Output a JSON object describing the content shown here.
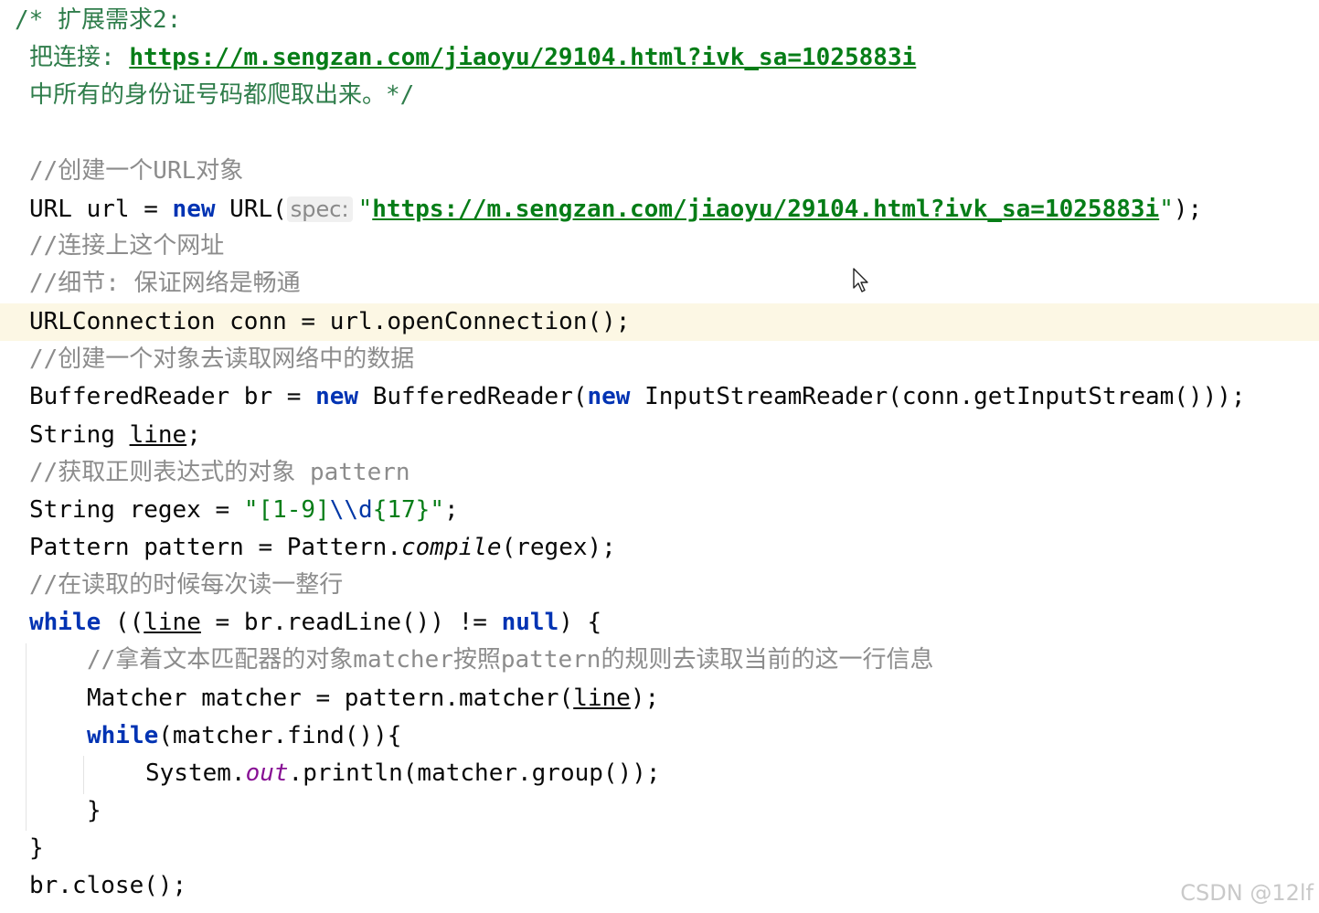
{
  "editor": {
    "lines": [
      {
        "id": "l1",
        "parts": [
          {
            "t": "/* 扩展需求2:",
            "c": "cmt-green"
          }
        ]
      },
      {
        "id": "l2",
        "parts": [
          {
            "t": "把连接: ",
            "c": "cmt-green"
          },
          {
            "t": "https://m.sengzan.com/jiaoyu/29104.html?ivk_sa=1025883i",
            "c": "url"
          }
        ]
      },
      {
        "id": "l3",
        "parts": [
          {
            "t": "中所有的身份证号码都爬取出来。*/",
            "c": "cmt-green"
          }
        ]
      },
      {
        "id": "l4",
        "parts": []
      },
      {
        "id": "l5",
        "parts": [
          {
            "t": "//创建一个URL对象",
            "c": "cmt"
          }
        ]
      },
      {
        "id": "l6",
        "parts": [
          {
            "t": "URL url = ",
            "c": ""
          },
          {
            "t": "new",
            "c": "kw"
          },
          {
            "t": " URL(",
            "c": ""
          },
          {
            "t": "spec:",
            "c": "hint"
          },
          {
            "t": "\"",
            "c": "str"
          },
          {
            "t": "https://m.sengzan.com/jiaoyu/29104.html?ivk_sa=1025883i",
            "c": "url"
          },
          {
            "t": "\"",
            "c": "str"
          },
          {
            "t": ");",
            "c": ""
          }
        ]
      },
      {
        "id": "l7",
        "parts": [
          {
            "t": "//连接上这个网址",
            "c": "cmt"
          }
        ]
      },
      {
        "id": "l8",
        "parts": [
          {
            "t": "//细节: 保证网络是畅通",
            "c": "cmt"
          }
        ]
      },
      {
        "id": "l9",
        "parts": [
          {
            "t": "URLConnection conn = url.openConnection();",
            "c": ""
          }
        ]
      },
      {
        "id": "l10",
        "parts": [
          {
            "t": "//创建一个对象去读取网络中的数据",
            "c": "cmt"
          }
        ]
      },
      {
        "id": "l11",
        "parts": [
          {
            "t": "BufferedReader br = ",
            "c": ""
          },
          {
            "t": "new",
            "c": "kw"
          },
          {
            "t": " BufferedReader(",
            "c": ""
          },
          {
            "t": "new",
            "c": "kw"
          },
          {
            "t": " InputStreamReader(conn.getInputStream()));",
            "c": ""
          }
        ]
      },
      {
        "id": "l12",
        "parts": [
          {
            "t": "String ",
            "c": ""
          },
          {
            "t": "line",
            "c": "var-ul"
          },
          {
            "t": ";",
            "c": ""
          }
        ]
      },
      {
        "id": "l13",
        "parts": [
          {
            "t": "//获取正则表达式的对象 pattern",
            "c": "cmt"
          }
        ]
      },
      {
        "id": "l14",
        "parts": [
          {
            "t": "String regex = ",
            "c": ""
          },
          {
            "t": "\"[1-9]",
            "c": "str"
          },
          {
            "t": "\\\\d",
            "c": "esc"
          },
          {
            "t": "{17}\"",
            "c": "str"
          },
          {
            "t": ";",
            "c": ""
          }
        ]
      },
      {
        "id": "l15",
        "parts": [
          {
            "t": "Pattern pattern = Pattern.",
            "c": ""
          },
          {
            "t": "compile",
            "c": "static"
          },
          {
            "t": "(regex);",
            "c": ""
          }
        ]
      },
      {
        "id": "l16",
        "parts": [
          {
            "t": "//在读取的时候每次读一整行",
            "c": "cmt"
          }
        ]
      },
      {
        "id": "l17",
        "parts": [
          {
            "t": "while",
            "c": "kw"
          },
          {
            "t": " ((",
            "c": ""
          },
          {
            "t": "line",
            "c": "var-ul"
          },
          {
            "t": " = br.readLine()) != ",
            "c": ""
          },
          {
            "t": "null",
            "c": "kw"
          },
          {
            "t": ") {",
            "c": ""
          }
        ]
      },
      {
        "id": "l18",
        "parts": [
          {
            "t": "//拿着文本匹配器的对象matcher按照pattern的规则去读取当前的这一行信息",
            "c": "cmt"
          }
        ]
      },
      {
        "id": "l19",
        "parts": [
          {
            "t": "Matcher matcher = pattern.matcher(",
            "c": ""
          },
          {
            "t": "line",
            "c": "var-ul"
          },
          {
            "t": ");",
            "c": ""
          }
        ]
      },
      {
        "id": "l20",
        "parts": [
          {
            "t": "while",
            "c": "kw"
          },
          {
            "t": "(matcher.find()){",
            "c": ""
          }
        ]
      },
      {
        "id": "l21",
        "parts": [
          {
            "t": "System.",
            "c": ""
          },
          {
            "t": "out",
            "c": "field"
          },
          {
            "t": ".println(matcher.group());",
            "c": ""
          }
        ]
      },
      {
        "id": "l22",
        "parts": [
          {
            "t": "}",
            "c": ""
          }
        ]
      },
      {
        "id": "l23",
        "parts": [
          {
            "t": "}",
            "c": ""
          }
        ]
      },
      {
        "id": "l24",
        "parts": [
          {
            "t": "br.close();",
            "c": ""
          }
        ]
      }
    ],
    "highlight_color": "#fcf7e4"
  },
  "watermark": "CSDN @12lf",
  "cursor_icon": "mouse-pointer-icon"
}
